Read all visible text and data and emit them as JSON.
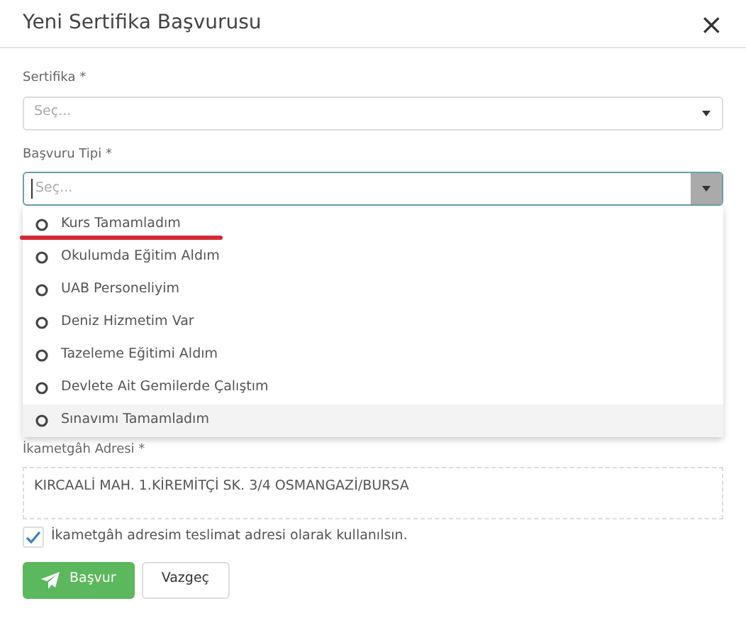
{
  "dialog": {
    "title": "Yeni Sertifika Başvurusu",
    "close": "×"
  },
  "fields": [
    {
      "label": "Sertifika *",
      "placeholder": "Seç...",
      "focused": false
    },
    {
      "label": "Başvuru Tipi *",
      "placeholder": "Seç...",
      "focused": true
    }
  ],
  "dropdown": {
    "options": [
      {
        "label": "Kurs Tamamladım",
        "highlighted": false,
        "underlined": true
      },
      {
        "label": "Okulumda Eğitim Aldım",
        "highlighted": false,
        "underlined": false
      },
      {
        "label": "UAB Personeliyim",
        "highlighted": false,
        "underlined": false
      },
      {
        "label": "Deniz Hizmetim Var",
        "highlighted": false,
        "underlined": false
      },
      {
        "label": "Tazeleme Eğitimi Aldım",
        "highlighted": false,
        "underlined": false
      },
      {
        "label": "Devlete Ait Gemilerde Çalıştım",
        "highlighted": false,
        "underlined": false
      },
      {
        "label": "Sınavımı Tamamladım",
        "highlighted": true,
        "underlined": false
      }
    ]
  },
  "address": {
    "label": "İkametgâh Adresi *",
    "value": "KIRCAALİ MAH. 1.KİREMİTÇİ SK. 3/4 OSMANGAZİ/BURSA"
  },
  "delivery_checkbox": {
    "label": "İkametgâh adresim teslimat adresi olarak kullanılsın.",
    "checked": true
  },
  "buttons": [
    {
      "label": "Başvur",
      "kind": "primary"
    },
    {
      "label": "Vazgeç",
      "kind": "secondary"
    }
  ]
}
